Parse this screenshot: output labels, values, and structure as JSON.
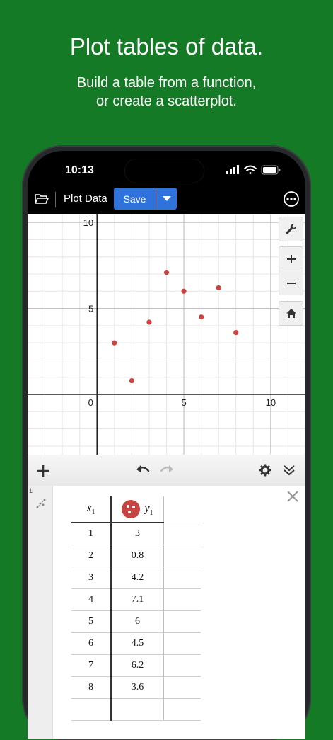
{
  "promo": {
    "headline": "Plot tables of data.",
    "subline_1": "Build a table from a function,",
    "subline_2": "or create a scatterplot."
  },
  "status_bar": {
    "time": "10:13"
  },
  "toolbar": {
    "folder_icon": "folder-icon",
    "title": "Plot Data",
    "save_label": "Save",
    "dropdown_icon": "chevron-down-icon",
    "more_icon": "ellipsis-circle-icon"
  },
  "graph": {
    "x_range": [
      -4,
      12
    ],
    "y_range": [
      -3.5,
      10.5
    ],
    "x_tick_labels": [
      "0",
      "5",
      "10"
    ],
    "y_tick_labels": [
      "5",
      "10"
    ],
    "point_color": "#c74440",
    "buttons": [
      "wrench-icon",
      "zoom-in-icon",
      "zoom-out-icon",
      "home-icon"
    ]
  },
  "expression_toolbar": {
    "add_icon": "plus-icon",
    "undo_icon": "undo-icon",
    "redo_icon": "redo-icon",
    "settings_icon": "gear-icon",
    "collapse_icon": "double-chevron-down-icon"
  },
  "expression_list": {
    "index": "1",
    "table": {
      "header_x": "x",
      "header_x_sub": "1",
      "header_y": "y",
      "header_y_sub": "1",
      "rows": [
        {
          "x": "1",
          "y": "3"
        },
        {
          "x": "2",
          "y": "0.8"
        },
        {
          "x": "3",
          "y": "4.2"
        },
        {
          "x": "4",
          "y": "7.1"
        },
        {
          "x": "5",
          "y": "6"
        },
        {
          "x": "6",
          "y": "4.5"
        },
        {
          "x": "7",
          "y": "6.2"
        },
        {
          "x": "8",
          "y": "3.6"
        }
      ]
    }
  },
  "chart_data": {
    "type": "scatter",
    "x": [
      1,
      2,
      3,
      4,
      5,
      6,
      7,
      8
    ],
    "y": [
      3,
      0.8,
      4.2,
      7.1,
      6,
      4.5,
      6.2,
      3.6
    ],
    "xlim": [
      -4,
      12
    ],
    "ylim": [
      -3.5,
      10.5
    ],
    "grid": true
  }
}
